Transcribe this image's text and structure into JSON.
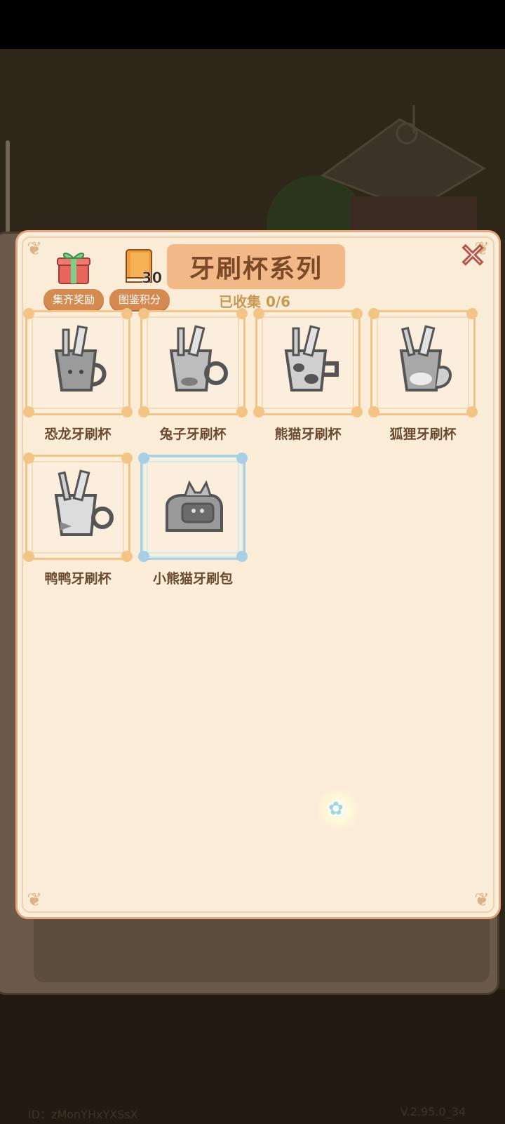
{
  "panel": {
    "title": "牙刷杯系列",
    "collected_text": "已收集 0/6",
    "reward_button": {
      "label": "集齐奖励",
      "icon": "gift-icon"
    },
    "book_button": {
      "label": "图鉴积分",
      "count": "30",
      "icon": "book-icon"
    },
    "close_icon": "close-icon"
  },
  "items": [
    {
      "name": "恐龙牙刷杯",
      "icon": "dinosaur-cup-icon",
      "frame": "gold"
    },
    {
      "name": "兔子牙刷杯",
      "icon": "rabbit-cup-icon",
      "frame": "gold"
    },
    {
      "name": "熊猫牙刷杯",
      "icon": "panda-cup-icon",
      "frame": "gold"
    },
    {
      "name": "狐狸牙刷杯",
      "icon": "fox-cup-icon",
      "frame": "gold"
    },
    {
      "name": "鸭鸭牙刷杯",
      "icon": "duck-cup-icon",
      "frame": "gold"
    },
    {
      "name": "小熊猫牙刷包",
      "icon": "red-panda-bag-icon",
      "frame": "blue"
    }
  ],
  "footer": {
    "id_text": "ID：zMonYHxYXSsX",
    "version": "V.2.95.0_34"
  },
  "colors": {
    "panel_bg": "#fbecd8",
    "title_bg": "#f2b887",
    "pill_bg": "#d58a52",
    "frame_gold": "#f2c587",
    "frame_blue": "#a8cfe6"
  }
}
